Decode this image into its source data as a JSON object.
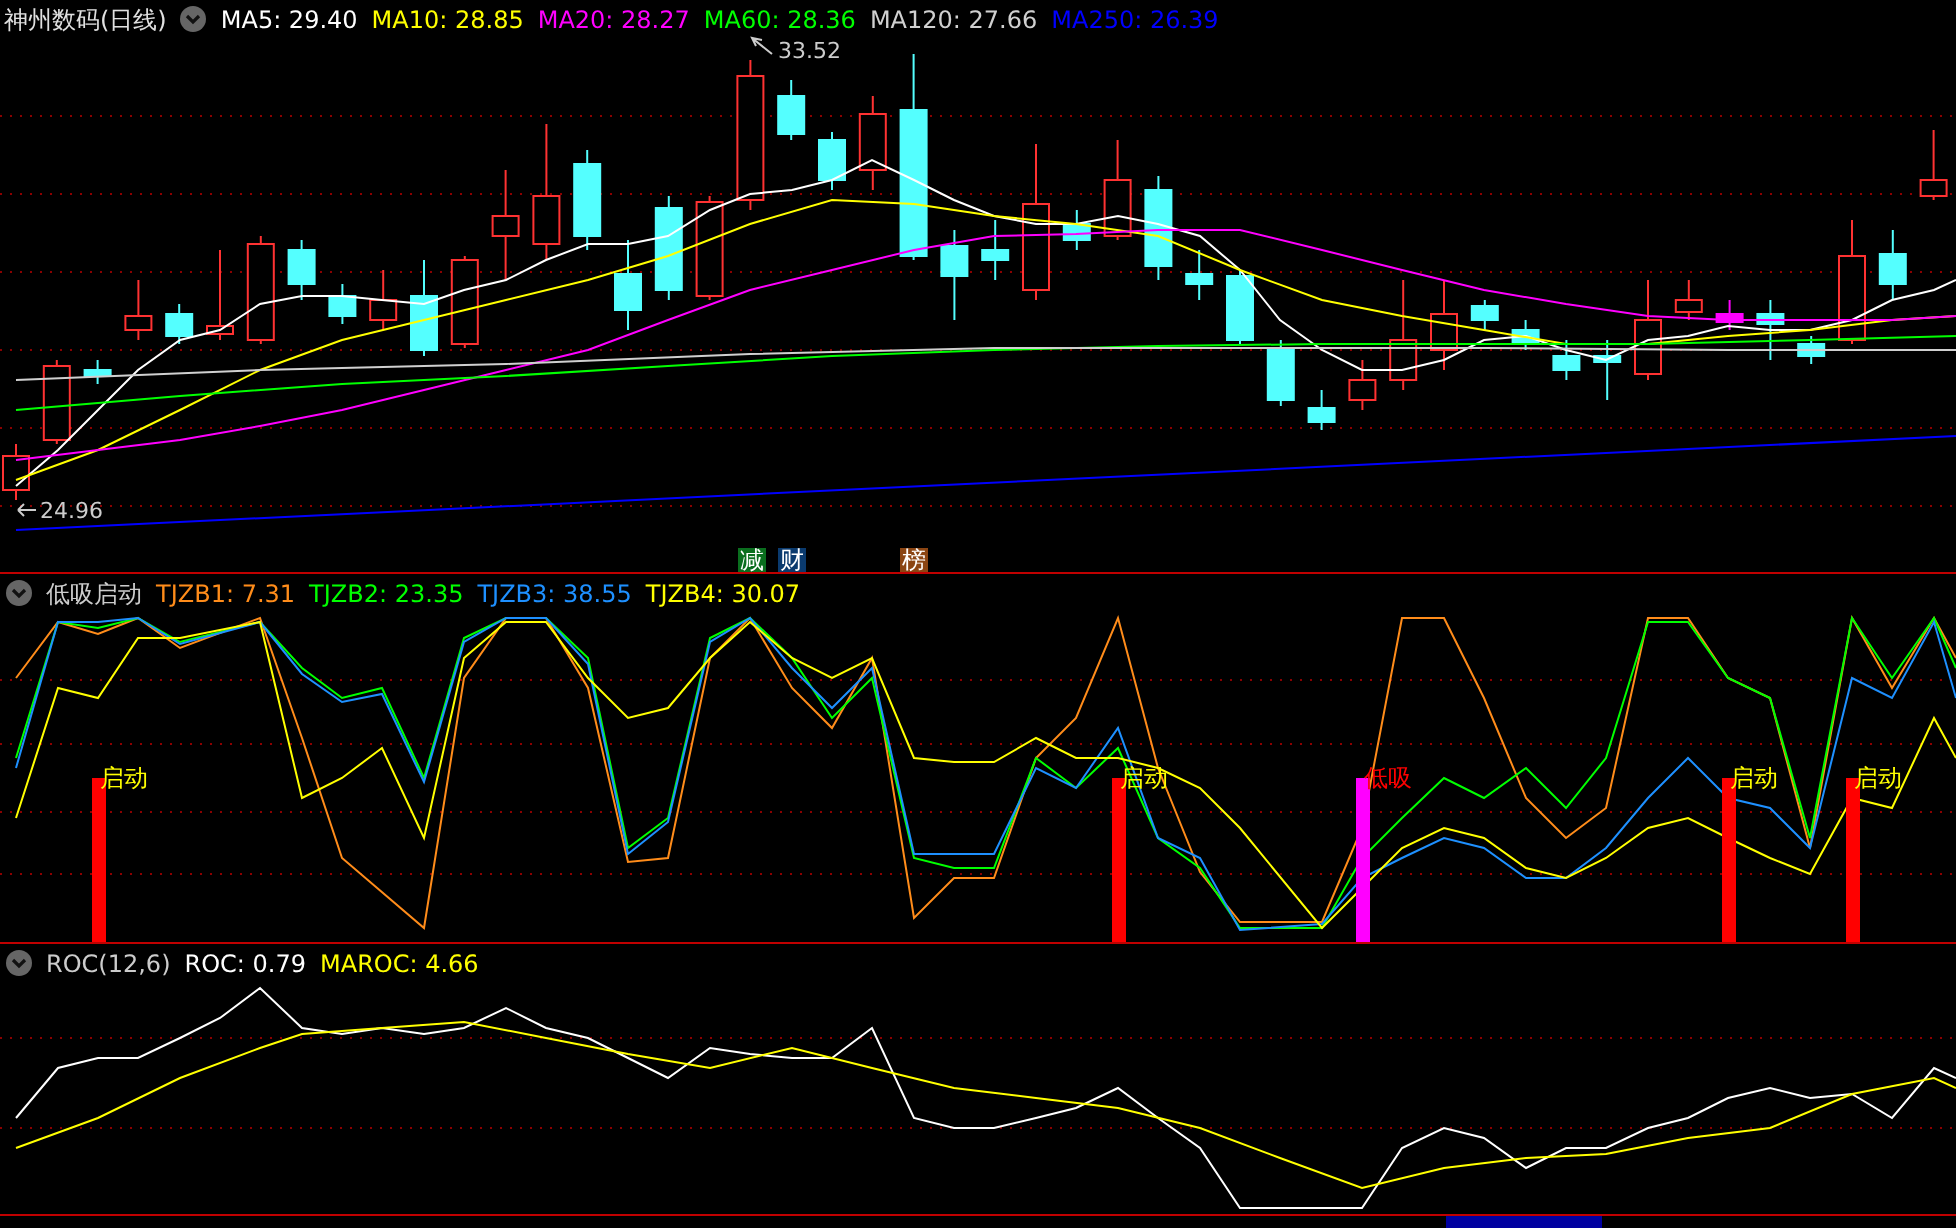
{
  "header": {
    "title": "神州数码(日线)",
    "ma": [
      {
        "label": "MA5: 29.40",
        "color": "#ffffff"
      },
      {
        "label": "MA10: 28.85",
        "color": "#ffff00"
      },
      {
        "label": "MA20: 28.27",
        "color": "#ff00ff"
      },
      {
        "label": "MA60: 28.36",
        "color": "#00ff00"
      },
      {
        "label": "MA120: 27.66",
        "color": "#d0d0d0"
      },
      {
        "label": "MA250: 26.39",
        "color": "#0000ff"
      }
    ]
  },
  "price_labels": {
    "high": "33.52",
    "low": "24.96"
  },
  "markers": [
    {
      "text": "减",
      "color": "#0a6e1e"
    },
    {
      "text": "财",
      "color": "#0a3a6e"
    },
    {
      "text": "榜",
      "color": "#8b4513"
    }
  ],
  "indicator": {
    "title": "低吸启动",
    "values": [
      {
        "label": "TJZB1: 7.31",
        "color": "#ff8c1a"
      },
      {
        "label": "TJZB2: 23.35",
        "color": "#00ff00"
      },
      {
        "label": "TJZB3: 38.55",
        "color": "#1e90ff"
      },
      {
        "label": "TJZB4: 30.07",
        "color": "#ffff00"
      }
    ],
    "signals": [
      {
        "text": "启动",
        "kind": "start"
      },
      {
        "text": "启动",
        "kind": "start"
      },
      {
        "text": "低吸",
        "kind": "dip"
      },
      {
        "text": "启动",
        "kind": "start"
      },
      {
        "text": "启动",
        "kind": "start"
      }
    ]
  },
  "roc": {
    "title": "ROC(12,6)",
    "values": [
      {
        "label": "ROC: 0.79",
        "color": "#ffffff"
      },
      {
        "label": "MAROC: 4.66",
        "color": "#ffff00"
      }
    ]
  }
}
